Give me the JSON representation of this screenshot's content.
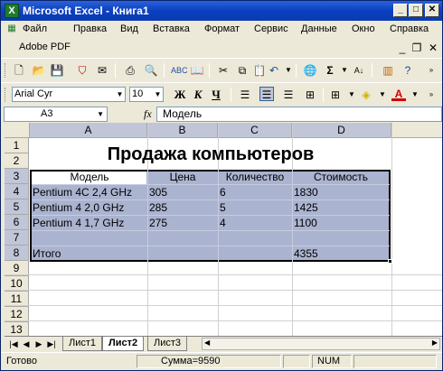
{
  "window": {
    "title": "Microsoft Excel - Книга1",
    "app_icon": "X"
  },
  "menu": [
    "Файл",
    "Правка",
    "Вид",
    "Вставка",
    "Формат",
    "Сервис",
    "Данные",
    "Окно",
    "Справка"
  ],
  "menu2": {
    "adobe": "Adobe PDF"
  },
  "toolbar": {
    "font": "Arial Cyr",
    "size": "10",
    "bold": "Ж",
    "italic": "К",
    "underline": "Ч",
    "sigma": "Σ"
  },
  "formula": {
    "name_box": "A3",
    "fx": "fx",
    "value": "Модель"
  },
  "columns": [
    "A",
    "B",
    "C",
    "D"
  ],
  "rows": [
    "1",
    "2",
    "3",
    "4",
    "5",
    "6",
    "7",
    "8",
    "9",
    "10",
    "11",
    "12",
    "13"
  ],
  "sheet": {
    "title": "Продажа компьютеров",
    "headers": [
      "Модель",
      "Цена",
      "Количество",
      "Стоимость"
    ],
    "data": [
      [
        "Pentium 4C 2,4 GHz",
        "305",
        "6",
        "1830"
      ],
      [
        "Pentium 4 2,0 GHz",
        "285",
        "5",
        "1425"
      ],
      [
        "Pentium 4 1,7 GHz",
        "275",
        "4",
        "1100"
      ]
    ],
    "total_label": "Итого",
    "total_value": "4355"
  },
  "tabs": [
    "Лист1",
    "Лист2",
    "Лист3"
  ],
  "status": {
    "ready": "Готово",
    "sum": "Сумма=9590",
    "num": "NUM"
  },
  "colors": {
    "selection": "#aab3cf",
    "title_bar": "#0a3fc0"
  }
}
